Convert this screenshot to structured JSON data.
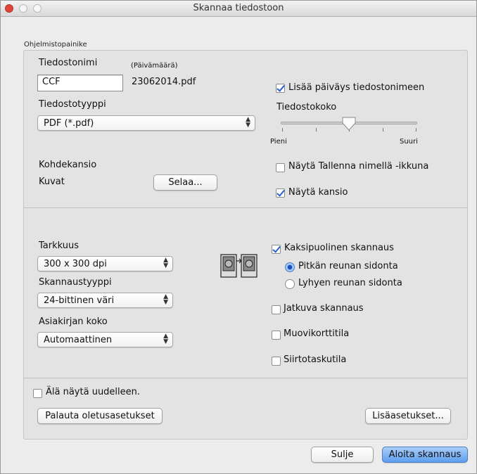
{
  "window": {
    "title": "Skannaa tiedostoon"
  },
  "group_label": "Ohjelmistopainike",
  "file": {
    "name_label": "Tiedostonimi",
    "date_hint": "(Päivämäärä)",
    "name_value": "CCF",
    "date_value": "23062014.pdf",
    "add_date_label": "Lisää päiväys tiedostonimeen",
    "add_date_checked": true,
    "type_label": "Tiedostotyyppi",
    "type_value": "PDF (*.pdf)",
    "size_label": "Tiedostokoko",
    "size_min_label": "Pieni",
    "size_max_label": "Suuri",
    "size_level": 0.5
  },
  "destination": {
    "label": "Kohdekansio",
    "folder": "Kuvat",
    "browse_label": "Selaa...",
    "show_save_as_label": "Näytä Tallenna nimellä -ikkuna",
    "show_save_as_checked": false,
    "show_folder_label": "Näytä kansio",
    "show_folder_checked": true
  },
  "scan": {
    "resolution_label": "Tarkkuus",
    "resolution_value": "300 x 300 dpi",
    "type_label": "Skannaustyyppi",
    "type_value": "24-bittinen väri",
    "doc_size_label": "Asiakirjan koko",
    "doc_size_value": "Automaattinen",
    "duplex_label": "Kaksipuolinen skannaus",
    "duplex_checked": true,
    "long_edge_label": "Pitkän reunan sidonta",
    "long_edge_selected": true,
    "short_edge_label": "Lyhyen reunan sidonta",
    "short_edge_selected": false,
    "continuous_label": "Jatkuva skannaus",
    "continuous_checked": false,
    "plastic_card_label": "Muovikorttitila",
    "plastic_card_checked": false,
    "carrier_sheet_label": "Siirtotaskutila",
    "carrier_sheet_checked": false
  },
  "footer": {
    "dont_show_label": "Älä näytä uudelleen.",
    "dont_show_checked": false,
    "restore_defaults_label": "Palauta oletusasetukset",
    "advanced_label": "Lisäasetukset...",
    "close_label": "Sulje",
    "start_label": "Aloita skannaus"
  }
}
